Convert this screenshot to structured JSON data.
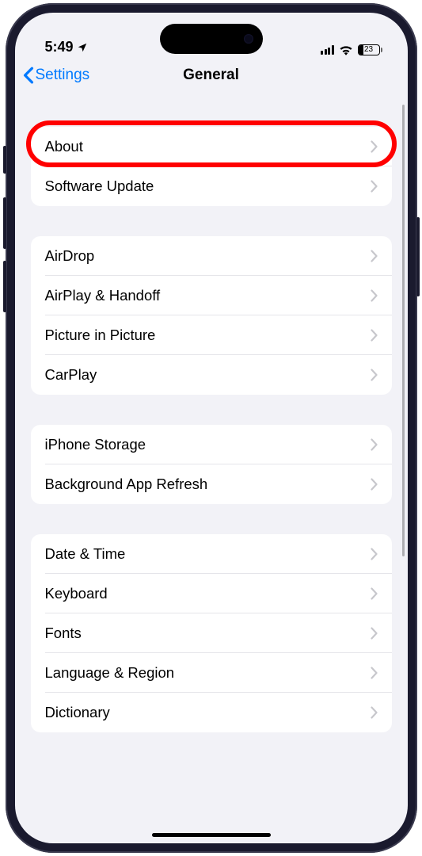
{
  "status_bar": {
    "time": "5:49",
    "battery": "23"
  },
  "nav": {
    "back_label": "Settings",
    "title": "General"
  },
  "sections": [
    {
      "rows": [
        {
          "label": "About",
          "highlighted": true
        },
        {
          "label": "Software Update"
        }
      ]
    },
    {
      "rows": [
        {
          "label": "AirDrop"
        },
        {
          "label": "AirPlay & Handoff"
        },
        {
          "label": "Picture in Picture"
        },
        {
          "label": "CarPlay"
        }
      ]
    },
    {
      "rows": [
        {
          "label": "iPhone Storage"
        },
        {
          "label": "Background App Refresh"
        }
      ]
    },
    {
      "rows": [
        {
          "label": "Date & Time"
        },
        {
          "label": "Keyboard"
        },
        {
          "label": "Fonts"
        },
        {
          "label": "Language & Region"
        },
        {
          "label": "Dictionary"
        }
      ]
    }
  ]
}
